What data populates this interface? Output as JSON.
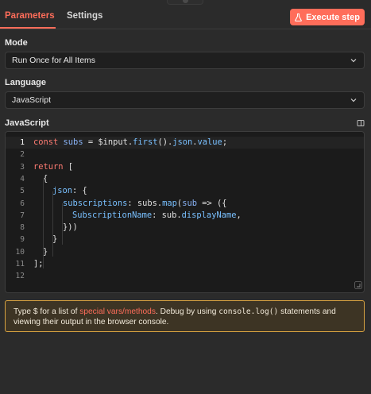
{
  "tabs": {
    "parameters": "Parameters",
    "settings": "Settings"
  },
  "execute_button": {
    "label": "Execute step",
    "icon": "flask-icon"
  },
  "mode": {
    "label": "Mode",
    "value": "Run Once for All Items"
  },
  "language": {
    "label": "Language",
    "value": "JavaScript"
  },
  "code_section": {
    "label": "JavaScript"
  },
  "code": {
    "line_numbers": [
      "1",
      "2",
      "3",
      "4",
      "5",
      "6",
      "7",
      "8",
      "9",
      "10",
      "11",
      "12"
    ],
    "line1": {
      "kw": "const",
      "v1": "subs",
      "eq": " = ",
      "obj": "$input",
      "d1": ".",
      "fn1": "first",
      "p1": "().",
      "fn2": "json",
      "d2": ".",
      "fn3": "value",
      "end": ";"
    },
    "line3": {
      "kw": "return",
      "rest": " ["
    },
    "line4": "{",
    "line5": {
      "key": "json",
      "rest": ": {"
    },
    "line6": {
      "key": "subscriptions",
      "c": ": ",
      "obj": "subs",
      "d": ".",
      "fn": "map",
      "p": "(",
      "arg": "sub",
      "arrow": " => ({"
    },
    "line7": {
      "key": "SubscriptionName",
      "c": ": ",
      "obj": "sub",
      "d": ".",
      "prop": "displayName",
      "end": ","
    },
    "line8": "}))",
    "line9": "}",
    "line10": "}",
    "line11": "];"
  },
  "hint": {
    "t1": "Type $ for a list of ",
    "link": "special vars/methods",
    "t2": ". Debug by using ",
    "code": "console.log()",
    "t3": " statements and viewing their output in the browser console."
  },
  "colors": {
    "accent": "#ff6d5a",
    "warning_border": "#d9a341"
  }
}
